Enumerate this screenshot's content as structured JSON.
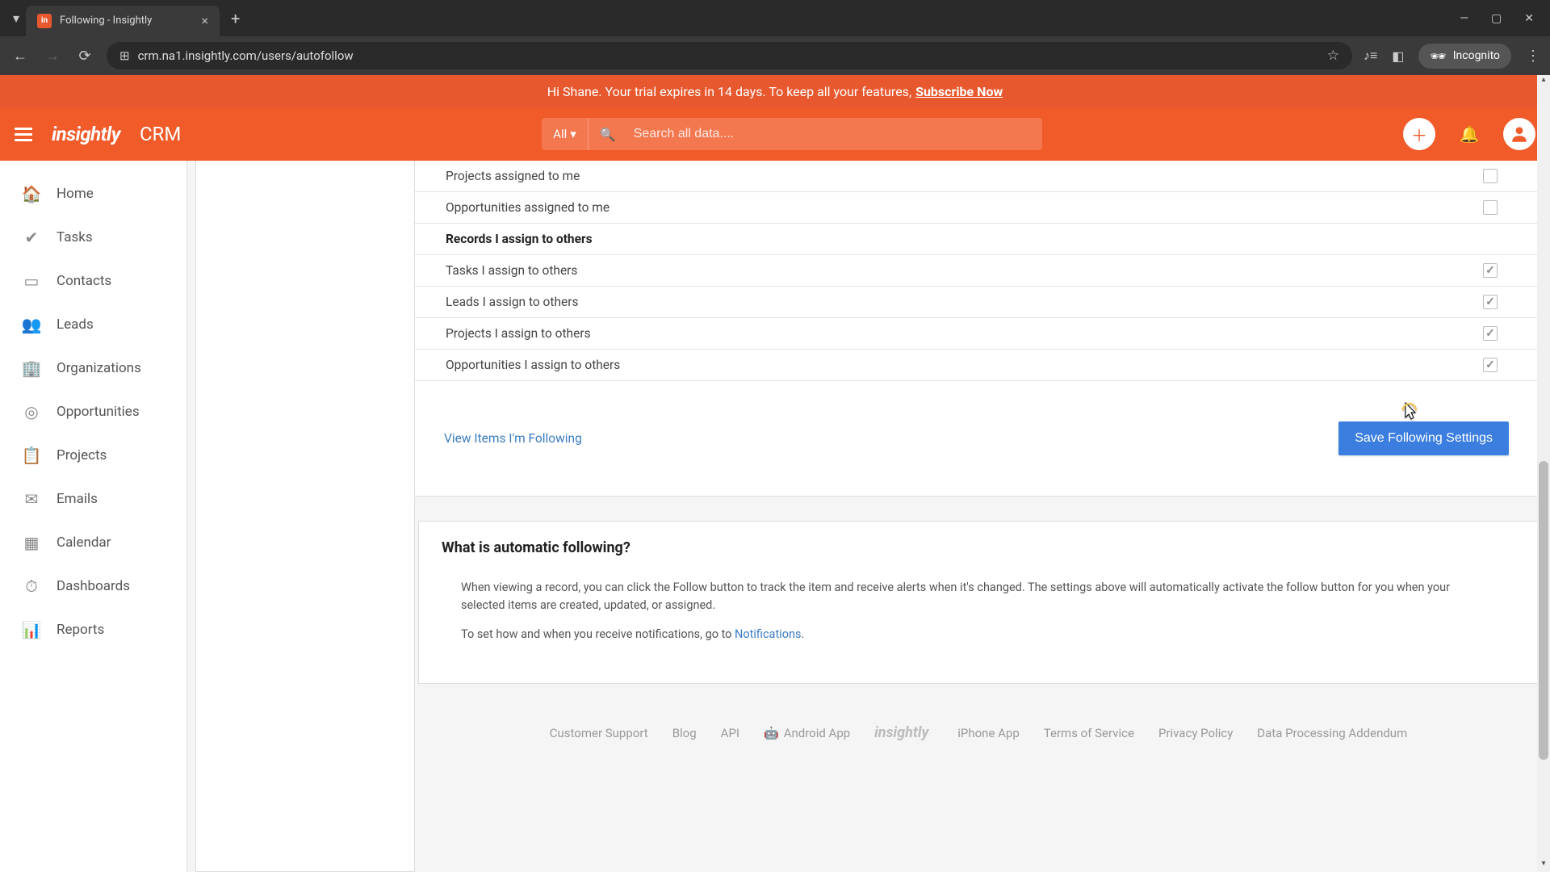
{
  "browser": {
    "tab_title": "Following - Insightly",
    "url": "crm.na1.insightly.com/users/autofollow",
    "incognito_label": "Incognito"
  },
  "trial_banner": {
    "greeting": "Hi Shane. Your trial expires in 14 days. To keep all your features,",
    "cta": "Subscribe Now"
  },
  "header": {
    "logo": "insightly",
    "product": "CRM",
    "search_filter": "All",
    "search_placeholder": "Search all data...."
  },
  "sidebar": {
    "items": [
      {
        "label": "Home"
      },
      {
        "label": "Tasks"
      },
      {
        "label": "Contacts"
      },
      {
        "label": "Leads"
      },
      {
        "label": "Organizations"
      },
      {
        "label": "Opportunities"
      },
      {
        "label": "Projects"
      },
      {
        "label": "Emails"
      },
      {
        "label": "Calendar"
      },
      {
        "label": "Dashboards"
      },
      {
        "label": "Reports"
      }
    ]
  },
  "settings": {
    "rows_assigned_me": [
      {
        "label": "Projects assigned to me",
        "checked": false
      },
      {
        "label": "Opportunities assigned to me",
        "checked": false
      }
    ],
    "section_header": "Records I assign to others",
    "rows_assign_others": [
      {
        "label": "Tasks I assign to others",
        "checked": true
      },
      {
        "label": "Leads I assign to others",
        "checked": true
      },
      {
        "label": "Projects I assign to others",
        "checked": true
      },
      {
        "label": "Opportunities I assign to others",
        "checked": true
      }
    ],
    "view_link": "View Items I'm Following",
    "save_button": "Save Following Settings"
  },
  "info": {
    "title": "What is automatic following?",
    "para1": "When viewing a record, you can click the Follow button to track the item and receive alerts when it's changed. The settings above will automatically activate the follow button for you when your selected items are created, updated, or assigned.",
    "para2_prefix": "To set how and when you receive notifications, go to ",
    "para2_link": "Notifications",
    "para2_suffix": "."
  },
  "footer": {
    "links": {
      "support": "Customer Support",
      "blog": "Blog",
      "api": "API",
      "android": "Android App",
      "logo": "insightly",
      "iphone": "iPhone App",
      "tos": "Terms of Service",
      "privacy": "Privacy Policy",
      "dpa": "Data Processing Addendum"
    }
  }
}
